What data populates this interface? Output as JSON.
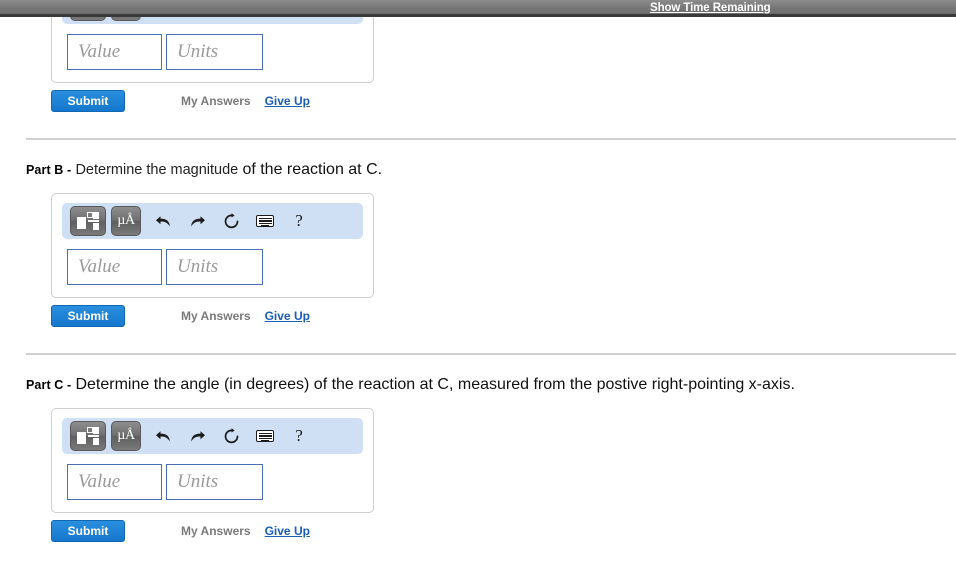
{
  "topbar": {
    "link_label": "Show Time Remaining"
  },
  "answer_widget": {
    "toolbar_icons": [
      "math-template-icon",
      "micro-angstrom-units-icon",
      "undo-icon",
      "redo-icon",
      "reset-icon",
      "keyboard-icon",
      "help-icon"
    ],
    "help_glyph": "?",
    "mu_label": "µÅ",
    "value_placeholder": "Value",
    "units_placeholder": "Units",
    "value_text": "",
    "units_text": ""
  },
  "actions": {
    "submit_label": "Submit",
    "my_answers_label": "My Answers",
    "give_up_label": "Give Up"
  },
  "parts": [
    {
      "tag": "",
      "text_a": "",
      "text_b": ""
    },
    {
      "tag": "Part B -",
      "text_a": "Determine the magnitude",
      "text_b": "of the reaction at C."
    },
    {
      "tag": "Part C -",
      "text_a": "Determine the angle (in degrees) of the reaction at C, measured from the postive right-pointing x-axis.",
      "text_b": ""
    }
  ],
  "colors": {
    "accent_blue": "#1577cd",
    "toolbar_blue": "#cfe0f5",
    "link_blue": "#1a5fb4",
    "header_gray": "#777777",
    "input_border": "#4a6fb5"
  }
}
